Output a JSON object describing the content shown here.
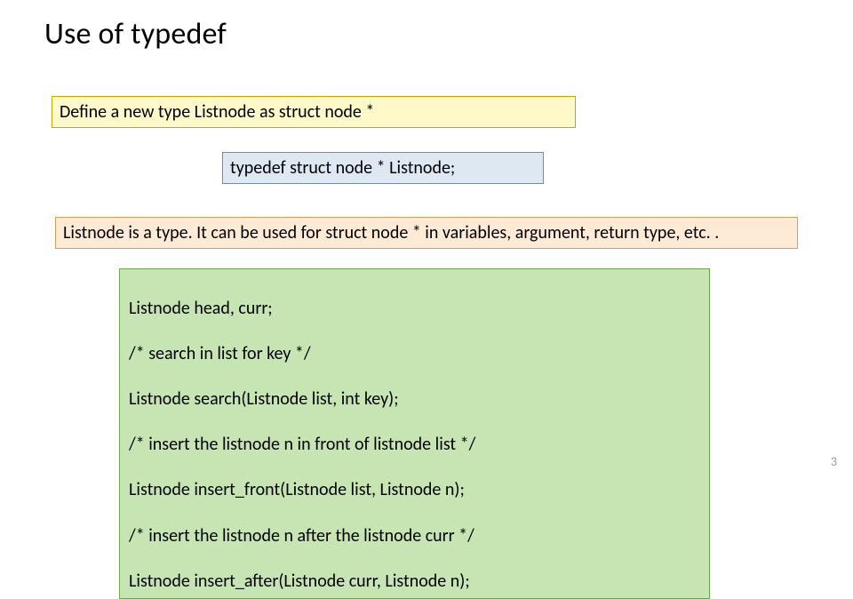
{
  "title": "Use of typedef",
  "yellow_text": "Define a new type Listnode as struct node *",
  "blue_text": "typedef struct node * Listnode;",
  "orange_text": "Listnode is a type. It can be used for struct node * in variables, argument, return type, etc. .",
  "green_lines": [
    "Listnode head, curr;",
    " /* search in list for key */",
    "Listnode search(Listnode list, int key);",
    "/* insert the listnode n in front of listnode list */",
    "Listnode insert_front(Listnode list, Listnode n);",
    " /* insert the listnode n after the listnode curr */",
    "Listnode insert_after(Listnode curr, Listnode n);"
  ],
  "page_number": "3"
}
